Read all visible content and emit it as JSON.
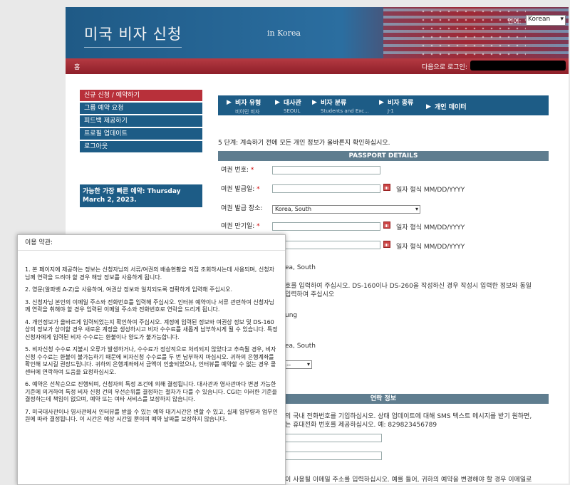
{
  "header": {
    "site_title": "미국 비자 신청",
    "site_subtitle": "in Korea",
    "language_label": "언어:",
    "language_selected": "Korean"
  },
  "navbar": {
    "home": "홈",
    "next_login": "다음으로 로그인:"
  },
  "sidebar": {
    "items": [
      {
        "label": "신규 신청 / 예약하기"
      },
      {
        "label": "그룹 예약 요청"
      },
      {
        "label": "피드백 제공하기"
      },
      {
        "label": "프로필 업데이트"
      },
      {
        "label": "로그아웃"
      }
    ],
    "earliest_appointment": "가능한 가장 빠른 예약: Thursday March 2, 2023."
  },
  "steps": [
    {
      "name": "비자 유형",
      "value": "비이민 비자"
    },
    {
      "name": "대사관",
      "value": "SEOUL"
    },
    {
      "name": "비자 분류",
      "value": "Students and Exc..."
    },
    {
      "name": "비자 종류",
      "value": "J-1"
    },
    {
      "name": "개인 데이터",
      "value": ""
    }
  ],
  "step_message": "5 단계: 계속하기 전에 모든 개인 정보가 올바른지 확인하십시오.",
  "passport": {
    "section_title": "PASSPORT DETAILS",
    "number_label": "여권 번호:",
    "issue_date_label": "여권 발급일:",
    "issue_place_label": "여권 발급 장소:",
    "issue_place_value": "Korea, South",
    "expiry_label": "여권 만기일:",
    "date_format": "일자 형식 MM/DD/YYYY",
    "req": "*"
  },
  "background": {
    "country1": "ea, South",
    "ds160_line1": "호를 입력하여 주십시오. DS-160이나 DS-260을 작성하신 경우 작성시 입력한 정보와 동일",
    "ds160_line2": "입력하여 주십시오",
    "name_fragment": "ung",
    "country2": "ea, South",
    "select_fragment": "음--",
    "contact_title": "연락 정보",
    "phone_line1": "의 국내 전화번호를 기입하십시오. 상태 업데이트에 대해 SMS 텍스트 메시지를 받기 원하면,",
    "phone_line2": "는 휴대전화 번호를 제공하십시오. 예: 829823456789",
    "email_line": "이 사용될 이메일 주소를 입력하십시오. 예를 들어, 귀하의 예약을 변경해야 할 경우 이메일로"
  },
  "terms": {
    "title": "이용 약관:",
    "items": [
      "1. 본 페이지에 제공하는 정보는 신청자님의 서류/여권의 배송현황을 직접 조회하시는데 사용되며, 신청자님께 연락을 드려야 할 경우 해당 정보를 사용하게 됩니다.",
      "2. 영문(알파벳 A-Z)을 사용하여, 여권상 정보와 일치되도록 정확하게 입력해 주십시오.",
      "3. 신청자님 본인의 이메일 주소와 전화번호를 입력해 주십시오. 인터뷰 예약이나 서류 관련하여 신청자님께 연락을 취해야 할 경우 입력된 이메일 주소와 전화번호로 연락을 드리게 됩니다.",
      "4. 개인정보가 올바르게 입력되었는지 확인하여 주십시오. 계정에 입력된 정보와 여권상 정보 및 DS-160상의 정보가 상이할 경우 새로운 계정을 생성하시고 비자 수수료를 새롭게 납부하시게 될 수 있습니다. 특정 신청자에게 입력된 비자 수수료는 환불이나 양도가 불가능합니다.",
      "5. 비자신청 수수료 지불시 오류가 발생하거나, 수수료가 정상적으로 처리되지 않았다고 추측될 경우, 비자신청 수수료는 환불이 불가능하기 때문에 비자신청 수수료를 두 번 납부하지 마십시오. 귀하의 은행계좌를 확인해 보시길 권장드립니다. 귀하의 은행계좌에서 금액이 인출되었으나, 인터뷰를 예약할 수 없는 경우 콜센터에 연락하여 도움을 요청하십시오.",
      "6. 예약은 선착순으로 진행되며, 신청자의 특정 조건에 의해 결정됩니다. 대사관과 영사관마다 변경 가능한 기준에 의거하여 특정 비자 신청 건의 우선순위를 결정하는 절차가 다를 수 있습니다. CGI는 이러한 기준을 결정하는데 책임이 없으며, 예약 또는 여타 서비스를 보장하지 않습니다.",
      "7. 미국대사관이나 영사관에서 인터뷰를 받을 수 있는 예약 대기시간은 변할 수 있고, 실제 업무량과 업무인원에 따라 결정됩니다. 이 시간은 예상 시간일 뿐이며 예약 날짜를 보장하지 않습니다."
    ]
  },
  "colors": {
    "nav_red": "#b53a42",
    "menu_blue": "#1d5c86",
    "section_gray": "#5f7d8f",
    "required": "#cc0000"
  }
}
